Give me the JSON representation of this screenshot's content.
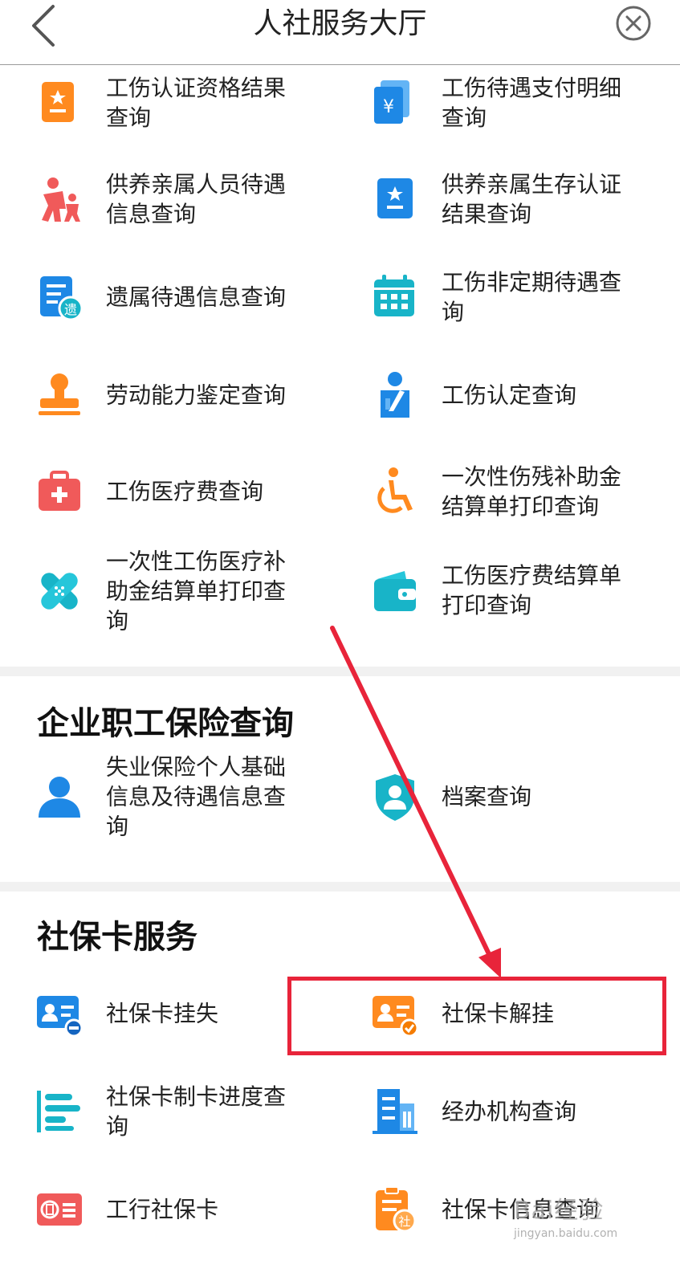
{
  "header": {
    "title": "人社服务大厅"
  },
  "items": [
    {
      "label": "工伤认证资格结果查询",
      "icon": "certificate-orange-icon"
    },
    {
      "label": "工伤待遇支付明细查询",
      "icon": "payment-document-icon"
    },
    {
      "label": "供养亲属人员待遇信息查询",
      "icon": "family-icon"
    },
    {
      "label": "供养亲属生存认证结果查询",
      "icon": "certificate-blue-icon"
    },
    {
      "label": "遗属待遇信息查询",
      "icon": "survivor-document-icon"
    },
    {
      "label": "工伤非定期待遇查询",
      "icon": "calendar-icon"
    },
    {
      "label": "劳动能力鉴定查询",
      "icon": "stamp-icon"
    },
    {
      "label": "工伤认定查询",
      "icon": "injured-person-icon"
    },
    {
      "label": "工伤医疗费查询",
      "icon": "medical-kit-icon"
    },
    {
      "label": "一次性伤残补助金结算单打印查询",
      "icon": "wheelchair-icon"
    },
    {
      "label": "一次性工伤医疗补助金结算单打印查询",
      "icon": "bandage-icon"
    },
    {
      "label": "工伤医疗费结算单打印查询",
      "icon": "wallet-icon"
    }
  ],
  "sections": {
    "enterprise": {
      "title": "企业职工保险查询",
      "items": [
        {
          "label": "失业保险个人基础信息及待遇信息查询",
          "icon": "user-icon"
        },
        {
          "label": "档案查询",
          "icon": "shield-user-icon"
        }
      ]
    },
    "card": {
      "title": "社保卡服务",
      "items": [
        {
          "label": "社保卡挂失",
          "icon": "card-loss-icon"
        },
        {
          "label": "社保卡解挂",
          "icon": "card-unlock-icon"
        },
        {
          "label": "社保卡制卡进度查询",
          "icon": "progress-bars-icon"
        },
        {
          "label": "经办机构查询",
          "icon": "building-icon"
        },
        {
          "label": "工行社保卡",
          "icon": "icbc-card-icon"
        },
        {
          "label": "社保卡信息查询",
          "icon": "card-info-icon"
        }
      ]
    }
  },
  "watermark": {
    "logo": "Bai经验",
    "url": "jingyan.baidu.com"
  },
  "colors": {
    "highlight": "#e8243a",
    "orange": "#ff8a1f",
    "blue": "#1e88e5",
    "teal": "#18b4c8",
    "red": "#f05a5a"
  }
}
